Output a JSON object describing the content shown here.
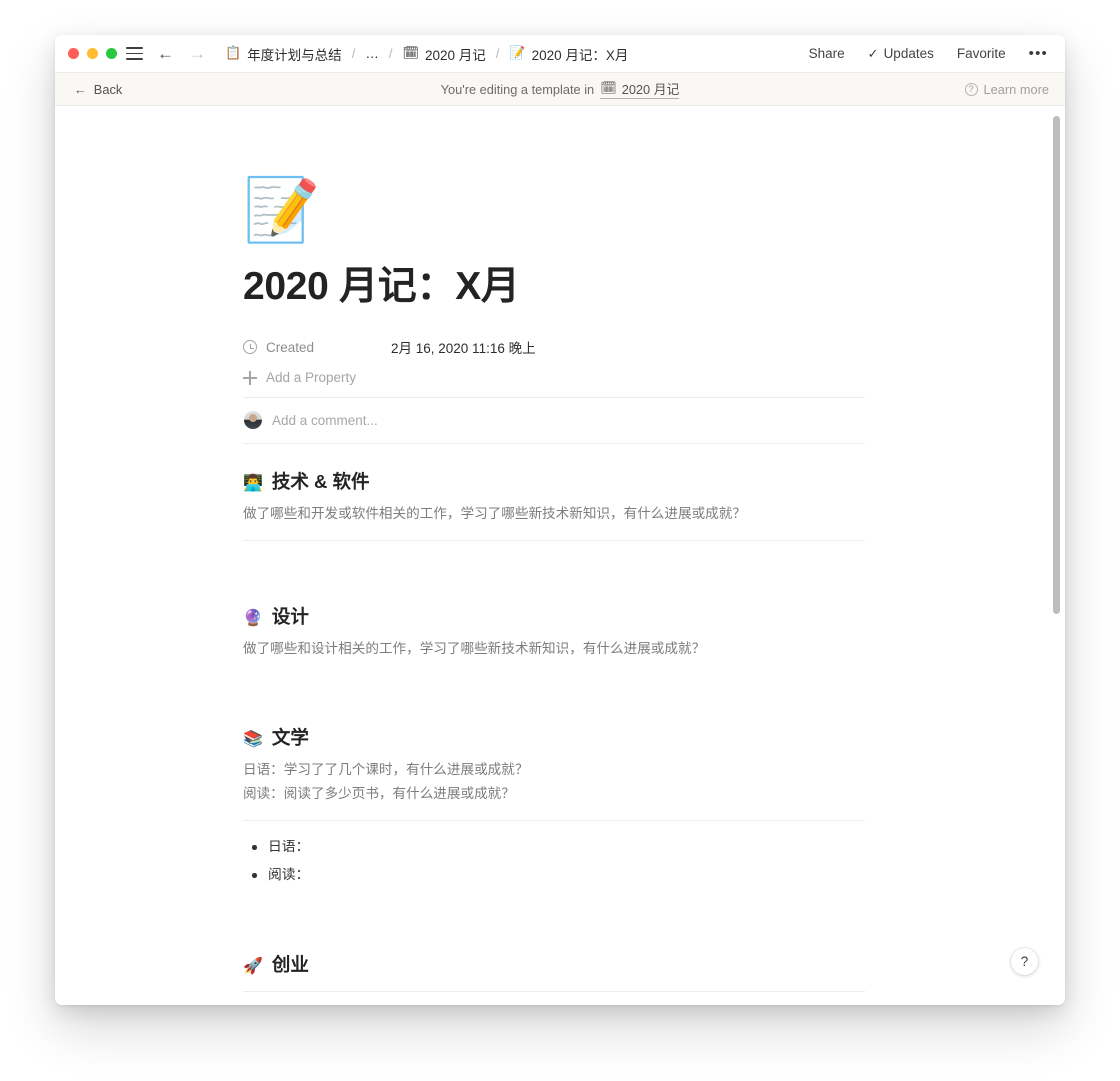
{
  "window": {
    "traffic_lights": [
      "close",
      "minimize",
      "zoom"
    ],
    "colors": {
      "close": "#ff5f57",
      "minimize": "#febc2e",
      "zoom": "#28c840",
      "banner_bg": "#faf8f5",
      "title_text": "#232323",
      "muted_text": "#7d7d7c"
    }
  },
  "titlebar": {
    "breadcrumb": [
      {
        "icon": "📋",
        "label": "年度计划与总结"
      },
      {
        "icon": "",
        "label": "…"
      },
      {
        "icon": "🗓",
        "label": "2020 月记"
      },
      {
        "icon": "📝",
        "label": "2020 月记：X月"
      }
    ],
    "separator": "/",
    "actions": {
      "share": "Share",
      "updates": "Updates",
      "favorite": "Favorite",
      "more": "•••"
    }
  },
  "banner": {
    "back": "Back",
    "message_prefix": "You're editing a template in",
    "database_icon": "🗓",
    "database_name": "2020 月记",
    "learn_more": "Learn more"
  },
  "page": {
    "icon": "📝",
    "title": "2020 月记：X月",
    "properties": [
      {
        "icon": "clock-icon",
        "name": "Created",
        "value": "2月 16, 2020 11:16 晚上"
      }
    ],
    "add_property": "Add a Property",
    "comment_placeholder": "Add a comment..."
  },
  "sections": [
    {
      "emoji": "👨‍💻",
      "heading": "技术 & 软件",
      "lines": [
        "做了哪些和开发或软件相关的工作，学习了哪些新技术新知识，有什么进展或成就？"
      ],
      "bullets": []
    },
    {
      "emoji": "🔮",
      "heading": "设计",
      "lines": [
        "做了哪些和设计相关的工作，学习了哪些新技术新知识，有什么进展或成就？"
      ],
      "bullets": []
    },
    {
      "emoji": "📚",
      "heading": "文学",
      "lines": [
        "日语：学习了了几个课时，有什么进展或成就？",
        "阅读：阅读了多少页书，有什么进展或成就？"
      ],
      "bullets": [
        "日语：",
        "阅读："
      ]
    },
    {
      "emoji": "🚀",
      "heading": "创业",
      "lines": [],
      "bullets": []
    }
  ],
  "help_button": {
    "label": "?"
  }
}
